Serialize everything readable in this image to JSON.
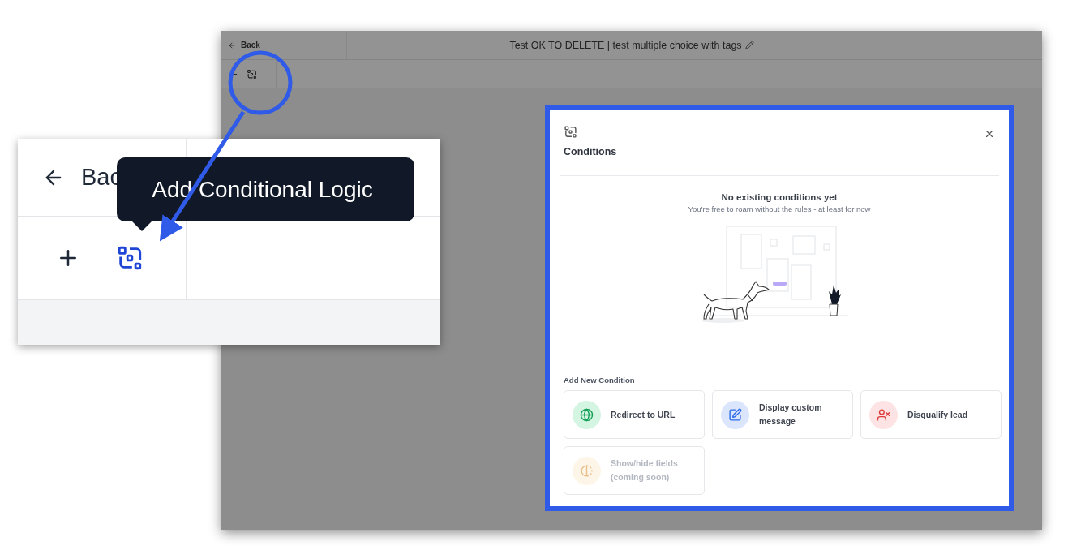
{
  "app": {
    "back": "Back",
    "title": "Test OK TO DELETE | test multiple choice with tags"
  },
  "modal": {
    "title": "Conditions",
    "empty_title": "No existing conditions yet",
    "empty_subtitle": "You're free to roam without the rules - at least for now",
    "section": "Add New Condition",
    "options": [
      {
        "kind": "redirect",
        "label": "Redirect to URL",
        "disabled": false
      },
      {
        "kind": "message",
        "label": "Display custom message",
        "disabled": false
      },
      {
        "kind": "disqualify",
        "label": "Disqualify lead",
        "disabled": false
      },
      {
        "kind": "showhide",
        "label": "Show/hide fields (coming soon)",
        "disabled": true
      }
    ]
  },
  "inset": {
    "back": "Bac",
    "tooltip": "Add Conditional Logic"
  }
}
